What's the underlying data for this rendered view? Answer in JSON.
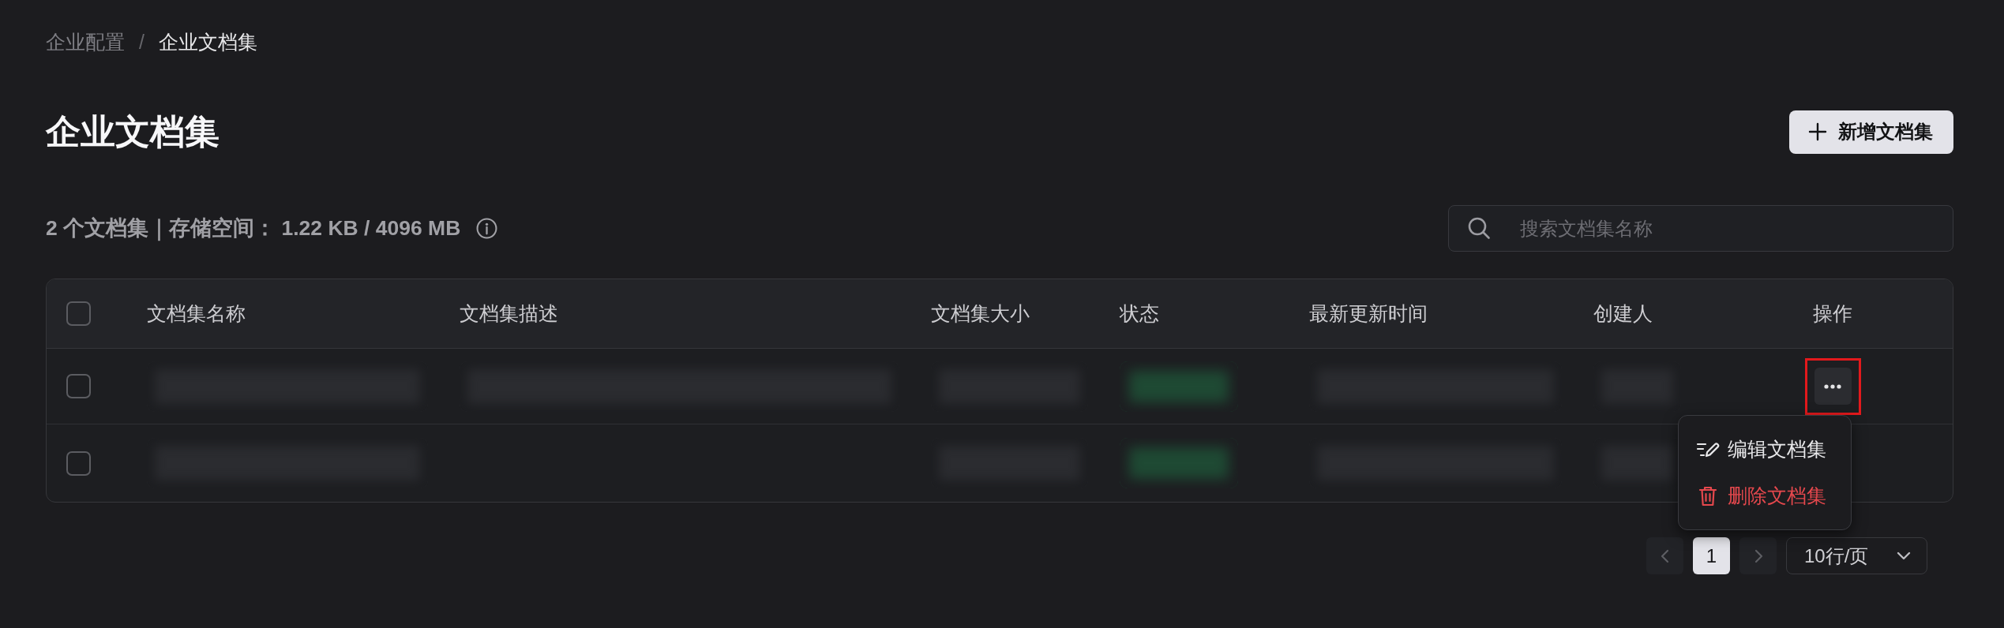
{
  "breadcrumb": {
    "items": [
      {
        "label": "企业配置",
        "current": false
      },
      {
        "label": "企业文档集",
        "current": true
      }
    ],
    "separator": "/"
  },
  "page_title": "企业文档集",
  "new_button": {
    "label": "新增文档集"
  },
  "summary": "2 个文档集｜存储空间： 1.22 KB / 4096 MB",
  "search": {
    "placeholder": "搜索文档集名称"
  },
  "table": {
    "select_all_checked": false,
    "columns": [
      "文档集名称",
      "文档集描述",
      "文档集大小",
      "状态",
      "最新更新时间",
      "创建人",
      "操作"
    ],
    "rows": [
      {
        "checked": false,
        "cells": [
          {
            "kind": "blurred"
          },
          {
            "kind": "blurred"
          },
          {
            "kind": "blurred"
          },
          {
            "kind": "blurred-tag"
          },
          {
            "kind": "blurred"
          },
          {
            "kind": "blurred"
          }
        ],
        "actions": {
          "highlighted": true,
          "menu_open": true,
          "menu": [
            {
              "kind": "edit",
              "label": "编辑文档集"
            },
            {
              "kind": "delete",
              "label": "删除文档集"
            }
          ]
        }
      },
      {
        "checked": false,
        "cells": [
          {
            "kind": "blurred"
          },
          {
            "kind": "empty"
          },
          {
            "kind": "blurred"
          },
          {
            "kind": "blurred-tag"
          },
          {
            "kind": "blurred"
          },
          {
            "kind": "blurred"
          }
        ]
      }
    ]
  },
  "pagination": {
    "prev_disabled": true,
    "pages": [
      {
        "label": "1",
        "selected": true
      }
    ],
    "next_disabled": true,
    "page_size": "10行/页"
  }
}
